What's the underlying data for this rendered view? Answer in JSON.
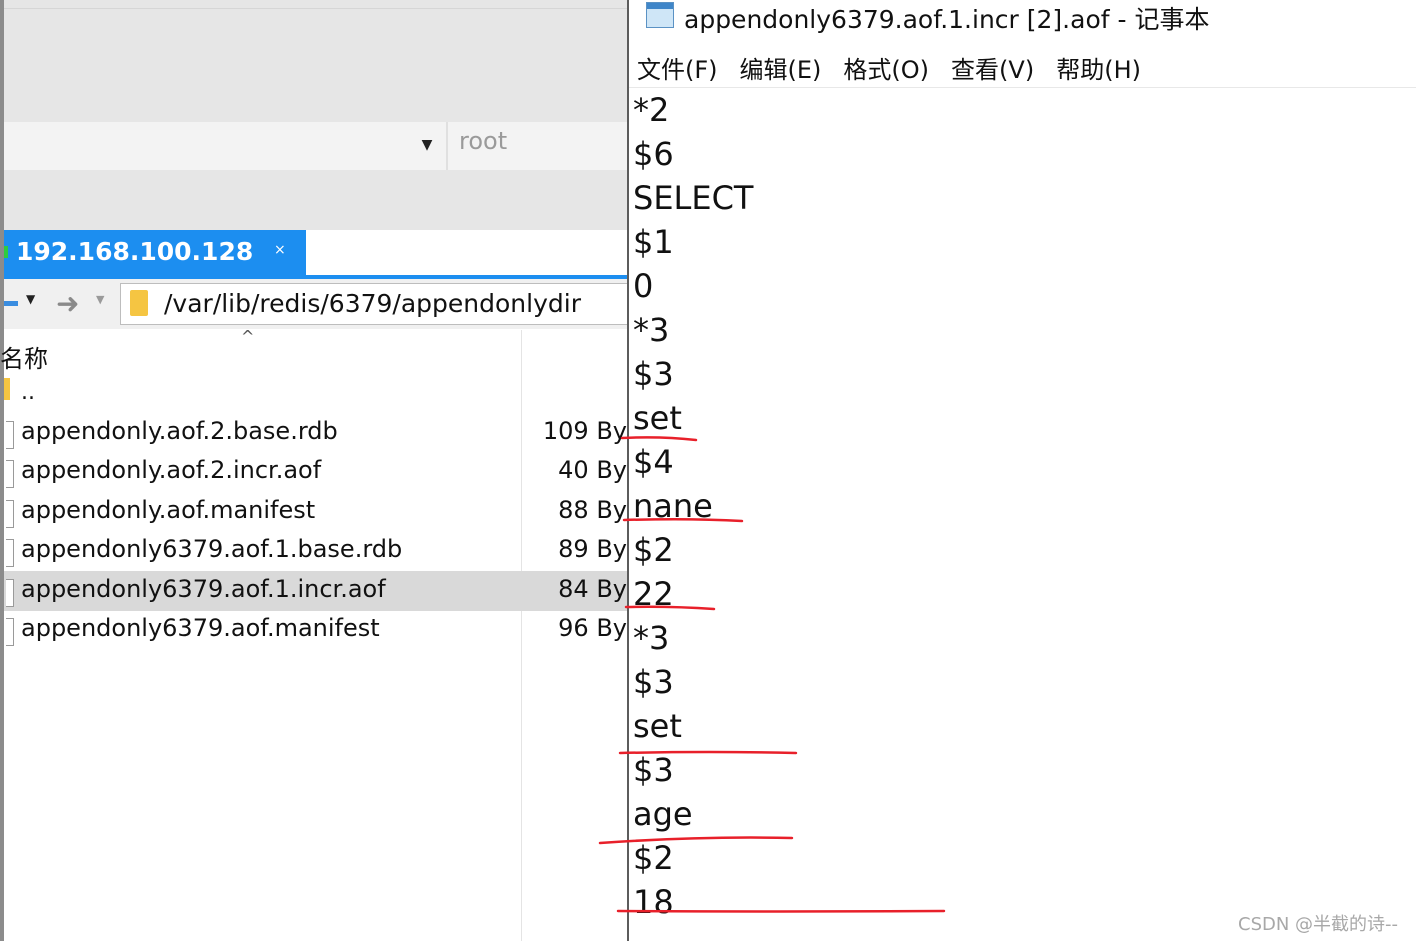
{
  "file_manager": {
    "user_field": "root",
    "tab": {
      "label": "192.168.100.128",
      "close": "×"
    },
    "address_path": "/var/lib/redis/6379/appendonlydir",
    "column_header_name": "名称",
    "parent_entry": "..",
    "files": [
      {
        "name": "appendonly.aof.2.base.rdb",
        "size": "109 By"
      },
      {
        "name": "appendonly.aof.2.incr.aof",
        "size": "40 By"
      },
      {
        "name": "appendonly.aof.manifest",
        "size": "88 By"
      },
      {
        "name": "appendonly6379.aof.1.base.rdb",
        "size": "89 By"
      },
      {
        "name": "appendonly6379.aof.1.incr.aof",
        "size": "84 By"
      },
      {
        "name": "appendonly6379.aof.manifest",
        "size": "96 By"
      }
    ],
    "selected_index": 4
  },
  "notepad": {
    "title": "appendonly6379.aof.1.incr [2].aof - 记事本",
    "menu": [
      "文件(F)",
      "编辑(E)",
      "格式(O)",
      "查看(V)",
      "帮助(H)"
    ],
    "lines": [
      "*2",
      "$6",
      "SELECT",
      "$1",
      "0",
      "*3",
      "$3",
      "set",
      "$4",
      "nane",
      "$2",
      "22",
      "*3",
      "$3",
      "set",
      "$3",
      "age",
      "$2",
      "18"
    ]
  },
  "watermark": "CSDN @半截的诗--",
  "colors": {
    "tab": "#1c8ef0",
    "annotation": "#e8202a",
    "selection": "#d9d9d9"
  }
}
